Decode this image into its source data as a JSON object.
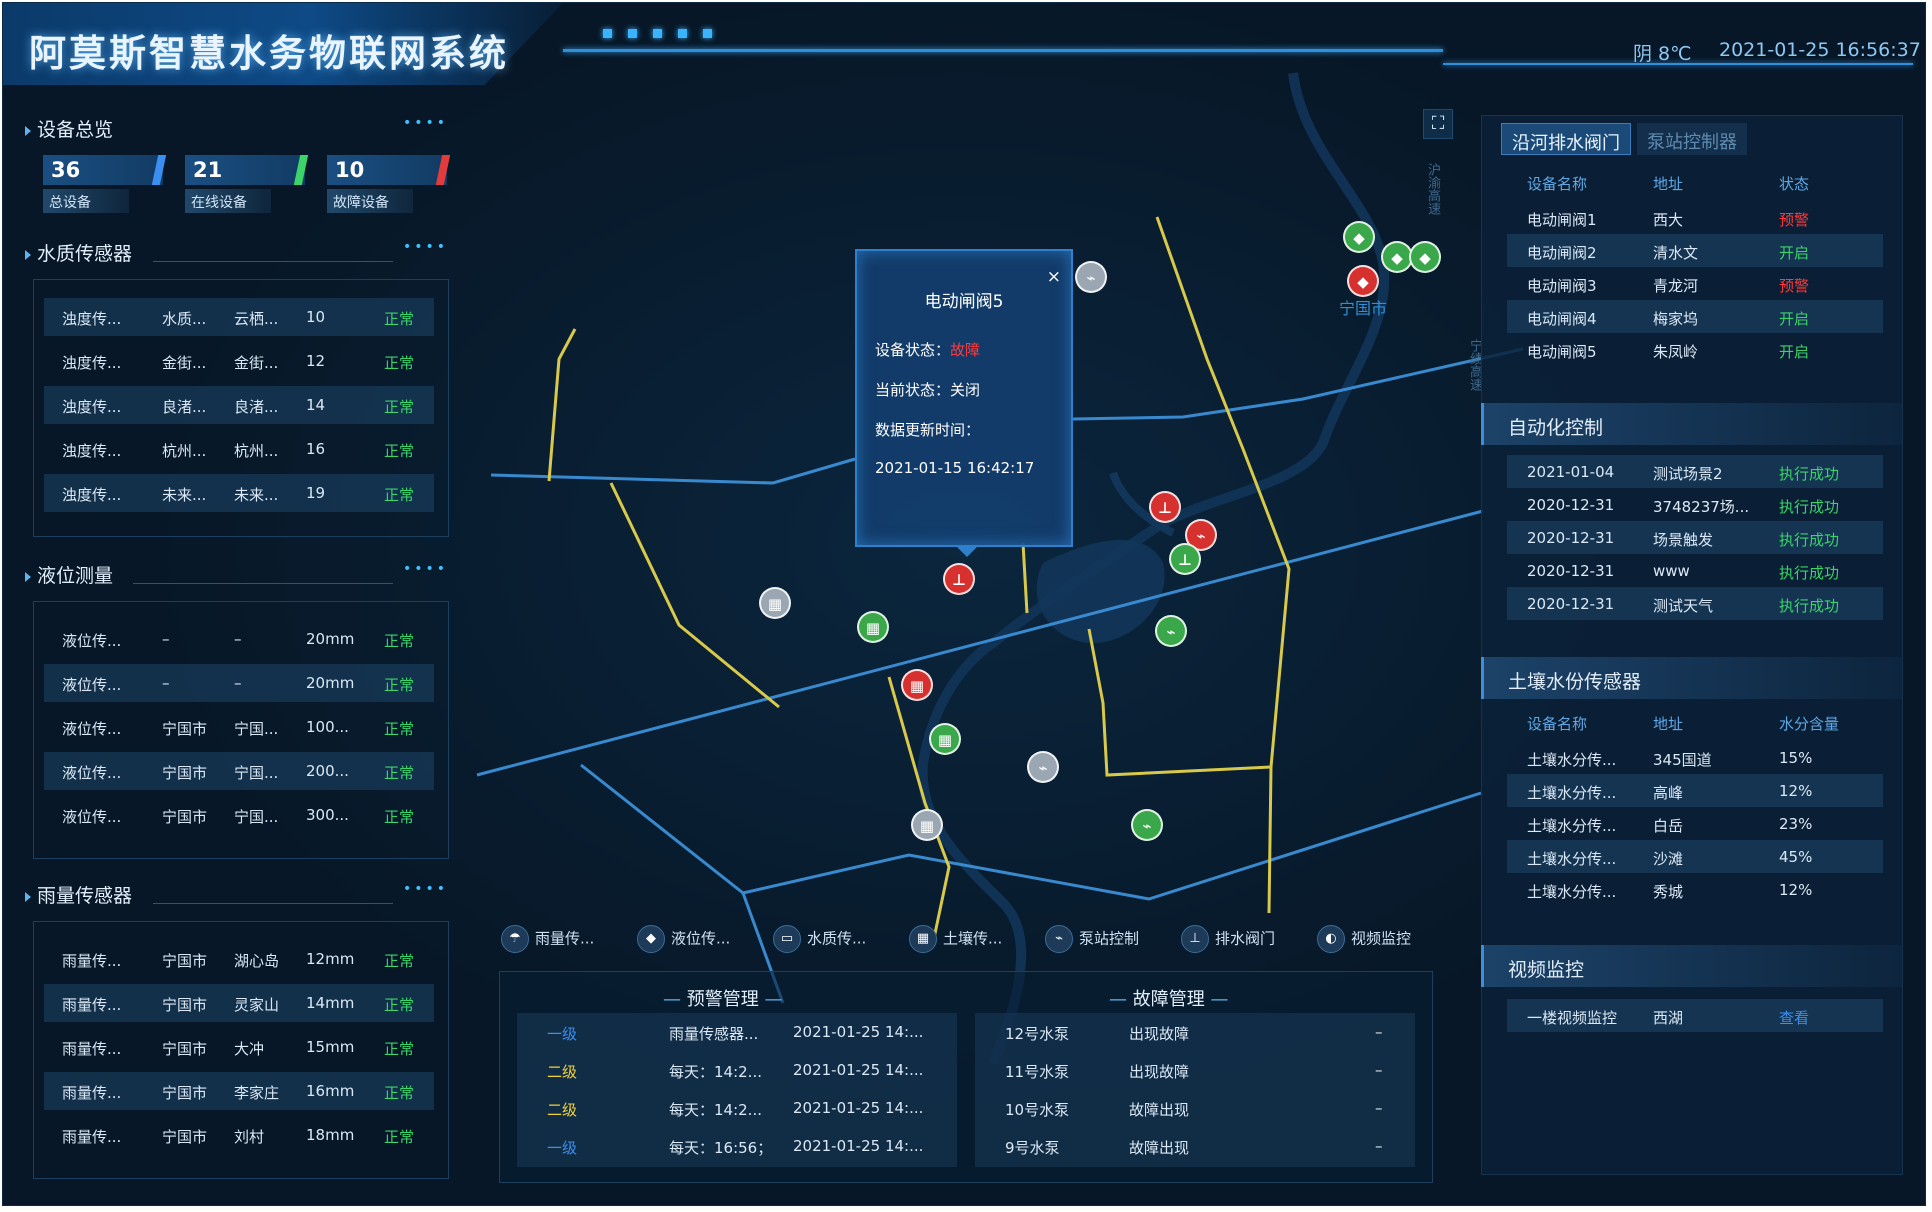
{
  "header": {
    "title": "阿莫斯智慧水务物联网系统",
    "weather": "阴 8℃",
    "datetime": "2021-01-25 16:56:37"
  },
  "overview": {
    "title": "设备总览",
    "stats": [
      {
        "value": "36",
        "label": "总设备",
        "color": "#3a8ff0"
      },
      {
        "value": "21",
        "label": "在线设备",
        "color": "#3bd36a"
      },
      {
        "value": "10",
        "label": "故障设备",
        "color": "#e23b3b"
      }
    ]
  },
  "water_quality": {
    "title": "水质传感器",
    "rows": [
      [
        "浊度传...",
        "水质...",
        "云栖...",
        "10",
        "正常"
      ],
      [
        "浊度传...",
        "金街...",
        "金街...",
        "12",
        "正常"
      ],
      [
        "浊度传...",
        "良渚...",
        "良渚...",
        "14",
        "正常"
      ],
      [
        "浊度传...",
        "杭州...",
        "杭州...",
        "16",
        "正常"
      ],
      [
        "浊度传...",
        "未来...",
        "未来...",
        "19",
        "正常"
      ]
    ]
  },
  "level": {
    "title": "液位测量",
    "rows": [
      [
        "液位传...",
        "–",
        "–",
        "20mm",
        "正常"
      ],
      [
        "液位传...",
        "–",
        "–",
        "20mm",
        "正常"
      ],
      [
        "液位传...",
        "宁国市",
        "宁国...",
        "100...",
        "正常"
      ],
      [
        "液位传...",
        "宁国市",
        "宁国...",
        "200...",
        "正常"
      ],
      [
        "液位传...",
        "宁国市",
        "宁国...",
        "300...",
        "正常"
      ]
    ]
  },
  "rain": {
    "title": "雨量传感器",
    "rows": [
      [
        "雨量传...",
        "宁国市",
        "湖心岛",
        "12mm",
        "正常"
      ],
      [
        "雨量传...",
        "宁国市",
        "灵家山",
        "14mm",
        "正常"
      ],
      [
        "雨量传...",
        "宁国市",
        "大冲",
        "15mm",
        "正常"
      ],
      [
        "雨量传...",
        "宁国市",
        "李家庄",
        "16mm",
        "正常"
      ],
      [
        "雨量传...",
        "宁国市",
        "刘村",
        "18mm",
        "正常"
      ]
    ]
  },
  "map": {
    "city": "宁国市",
    "road_a": "沪渝高速",
    "road_b": "宁绩高速",
    "fullscreen_icon": "⛶",
    "popup": {
      "title": "电动闸阀5",
      "close": "×",
      "status_label": "设备状态：",
      "status_value": "故障",
      "current_label": "当前状态：关闭",
      "update_label": "数据更新时间：",
      "update_time": "2021-01-15 16:42:17"
    },
    "pins": [
      {
        "color": "gray",
        "icon": "pump-icon"
      },
      {
        "color": "green",
        "icon": "valve-icon"
      },
      {
        "color": "green",
        "icon": "valve-icon"
      },
      {
        "color": "green",
        "icon": "valve-icon"
      },
      {
        "color": "red",
        "icon": "valve-icon"
      },
      {
        "color": "red",
        "icon": "gate-icon"
      },
      {
        "color": "red",
        "icon": "pump-icon"
      },
      {
        "color": "green",
        "icon": "gate-icon"
      },
      {
        "color": "red",
        "icon": "gate-icon"
      },
      {
        "color": "gray",
        "icon": "monitor-icon"
      },
      {
        "color": "green",
        "icon": "monitor-icon"
      },
      {
        "color": "green",
        "icon": "pump-icon"
      },
      {
        "color": "red",
        "icon": "monitor-icon"
      },
      {
        "color": "green",
        "icon": "monitor-icon"
      },
      {
        "color": "gray",
        "icon": "pump-icon"
      },
      {
        "color": "gray",
        "icon": "monitor-icon"
      },
      {
        "color": "green",
        "icon": "pump-icon"
      }
    ]
  },
  "layers": [
    {
      "label": "雨量传...",
      "icon": "rain-icon"
    },
    {
      "label": "液位传...",
      "icon": "level-icon"
    },
    {
      "label": "水质传...",
      "icon": "quality-icon"
    },
    {
      "label": "土壤传...",
      "icon": "soil-icon"
    },
    {
      "label": "泵站控制",
      "icon": "pump-icon"
    },
    {
      "label": "排水阀门",
      "icon": "valve-icon"
    },
    {
      "label": "视频监控",
      "icon": "camera-icon"
    }
  ],
  "warnings": {
    "title": "预警管理",
    "rows": [
      [
        "一级",
        "雨量传感器...",
        "2021-01-25 14:..."
      ],
      [
        "二级",
        "每天：14:2...",
        "2021-01-25 14:..."
      ],
      [
        "二级",
        "每天：14:2...",
        "2021-01-25 14:..."
      ],
      [
        "一级",
        "每天：16:56；",
        "2021-01-25 14:..."
      ]
    ]
  },
  "faults": {
    "title": "故障管理",
    "rows": [
      [
        "12号水泵",
        "出现故障",
        "–"
      ],
      [
        "11号水泵",
        "出现故障",
        "–"
      ],
      [
        "10号水泵",
        "故障出现",
        "–"
      ],
      [
        "9号水泵",
        "故障出现",
        "–"
      ]
    ]
  },
  "valves": {
    "tabs": [
      "沿河排水阀门",
      "泵站控制器"
    ],
    "headers": [
      "设备名称",
      "地址",
      "状态"
    ],
    "rows": [
      [
        "电动闸阀1",
        "西大",
        "预警"
      ],
      [
        "电动闸阀2",
        "清水文",
        "开启"
      ],
      [
        "电动闸阀3",
        "青龙河",
        "预警"
      ],
      [
        "电动闸阀4",
        "梅家坞",
        "开启"
      ],
      [
        "电动闸阀5",
        "朱凤岭",
        "开启"
      ]
    ]
  },
  "automation": {
    "title": "自动化控制",
    "rows": [
      [
        "2021-01-04",
        "测试场景2",
        "执行成功"
      ],
      [
        "2020-12-31",
        "3748237场...",
        "执行成功"
      ],
      [
        "2020-12-31",
        "场景触发",
        "执行成功"
      ],
      [
        "2020-12-31",
        "www",
        "执行成功"
      ],
      [
        "2020-12-31",
        "测试天气",
        "执行成功"
      ]
    ]
  },
  "soil": {
    "title": "土壤水份传感器",
    "headers": [
      "设备名称",
      "地址",
      "水分含量"
    ],
    "rows": [
      [
        "土壤水分传...",
        "345国道",
        "15%"
      ],
      [
        "土壤水分传...",
        "高峰",
        "12%"
      ],
      [
        "土壤水分传...",
        "白岳",
        "23%"
      ],
      [
        "土壤水分传...",
        "沙滩",
        "45%"
      ],
      [
        "土壤水分传...",
        "秀城",
        "12%"
      ]
    ]
  },
  "video": {
    "title": "视频监控",
    "rows": [
      [
        "一楼视频监控",
        "西湖",
        "查看"
      ]
    ]
  }
}
